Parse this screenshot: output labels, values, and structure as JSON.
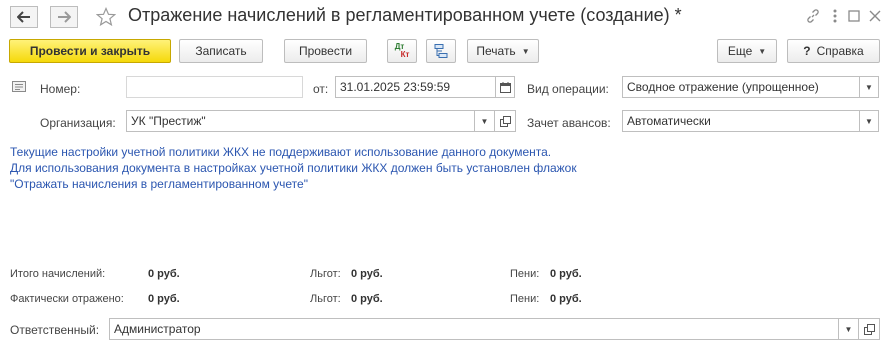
{
  "header": {
    "title": "Отражение начислений в регламентированном учете (создание) *",
    "back_icon": "arrow-left-icon",
    "forward_icon": "arrow-right-icon",
    "favorite_icon": "star-icon",
    "link_icon": "link-icon",
    "menu_icon": "more-vertical-icon",
    "maximize_icon": "maximize-icon",
    "close_icon": "close-icon"
  },
  "toolbar": {
    "post_close_label": "Провести и закрыть",
    "save_label": "Записать",
    "post_label": "Провести",
    "dtkt_label_top": "Дт",
    "dtkt_label_bottom": "Кт",
    "print_label": "Печать",
    "more_label": "Еще",
    "help_label": "Справка",
    "help_prefix": "?"
  },
  "form": {
    "number_label": "Номер:",
    "number_value": "",
    "from_label": "от:",
    "date_value": "31.01.2025 23:59:59",
    "operation_label": "Вид операции:",
    "operation_value": "Сводное отражение (упрощенное)",
    "org_label": "Организация:",
    "org_value": "УК \"Престиж\"",
    "advance_label": "Зачет авансов:",
    "advance_value": "Автоматически"
  },
  "info": {
    "line1": "Текущие настройки учетной политики ЖКХ не поддерживают использование данного документа.",
    "line2": "Для использования документа в настройках учетной политики ЖКХ должен быть установлен флажок",
    "line3": "\"Отражать начисления в регламентированном учете\""
  },
  "totals": {
    "accrued_label": "Итого начислений:",
    "accrued_value": "0 руб.",
    "benefits_label_1": "Льгот:",
    "benefits_value_1": "0 руб.",
    "penalty_label_1": "Пени:",
    "penalty_value_1": "0 руб.",
    "reflected_label": "Фактически отражено:",
    "reflected_value": "0 руб.",
    "benefits_label_2": "Льгот:",
    "benefits_value_2": "0 руб.",
    "penalty_label_2": "Пени:",
    "penalty_value_2": "0 руб."
  },
  "responsible": {
    "label": "Ответственный:",
    "value": "Администратор"
  },
  "colors": {
    "primary_button": "#f5d90a",
    "info_text": "#2b56b0"
  }
}
